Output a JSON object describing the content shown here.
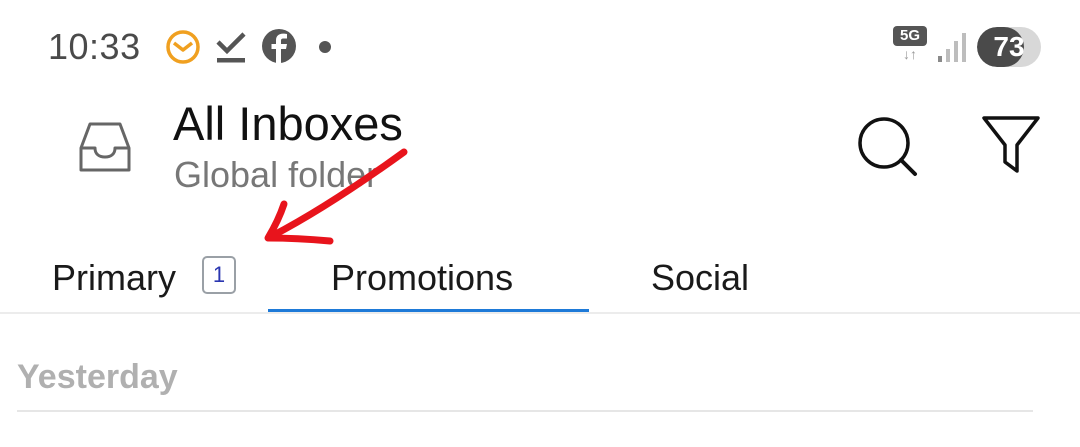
{
  "status_bar": {
    "time": "10:33",
    "icons": [
      "mail-app-notification-icon",
      "download-done-icon",
      "facebook-icon",
      "more-notifications-dot"
    ],
    "network_label": "5G",
    "network_arrows": "↓↑",
    "battery_level": "73",
    "battery_fraction": 0.73
  },
  "header": {
    "title": "All Inboxes",
    "subtitle": "Global folder"
  },
  "tabs": [
    {
      "label": "Primary",
      "badge": "1",
      "selected": false
    },
    {
      "label": "Promotions",
      "selected": true
    },
    {
      "label": "Social",
      "selected": false
    }
  ],
  "list": {
    "section_header": "Yesterday"
  },
  "colors": {
    "accent": "#1e7ad8",
    "annotation": "#e8141c",
    "mail_icon": "#f0a020",
    "badge_text": "#2a36b0"
  }
}
